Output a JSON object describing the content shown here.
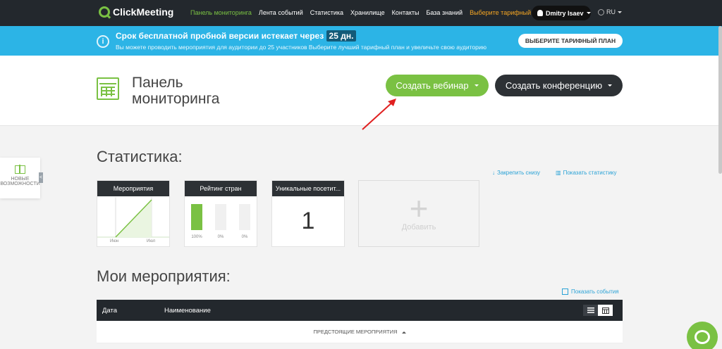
{
  "nav": {
    "logo": "ClickMeeting",
    "links": [
      "Панель мониторинга",
      "Лента событий",
      "Статистика",
      "Хранилище",
      "Контакты",
      "База знаний"
    ],
    "plan_link": "Выберите тарифный план",
    "user": "Dmitry Isaev",
    "lang": "RU"
  },
  "banner": {
    "title": "Срок бесплатной пробной версии истекает через",
    "days": "25 дн.",
    "subtitle": "Вы можете проводить мероприятия для аудитории до 25 участников Выберите лучший тарифный план и увеличьте свою аудиторию",
    "button": "ВЫБЕРИТЕ ТАРИФНЫЙ ПЛАН",
    "info_icon": "i"
  },
  "header": {
    "title": "Панель мониторинга",
    "webinar_button": "Создать вебинар",
    "conference_button": "Создать конференцию"
  },
  "side_panel": {
    "label": "НОВЫЕ ВОЗМОЖНОСТИ",
    "tab": "<"
  },
  "stats": {
    "title": "Статистика:",
    "pin_link": "Закрепить снизу",
    "show_link": "Показать статистику",
    "cards": [
      {
        "title": "Мероприятия",
        "x_labels": [
          "Июн",
          "Июл"
        ]
      },
      {
        "title": "Рейтинг стран",
        "bars": [
          100,
          0,
          0
        ],
        "bar_labels": [
          "100%",
          "0%",
          "0%"
        ]
      },
      {
        "title": "Уникальные посетит...",
        "value": "1"
      }
    ],
    "add_label": "Добавить",
    "add_symbol": "+"
  },
  "events": {
    "title": "Мои мероприятия:",
    "show_link": "Показать события",
    "col_date": "Дата",
    "col_name": "Наименование",
    "upcoming": "ПРЕДСТОЯЩИЕ МЕРОПРИЯТИЯ"
  },
  "colors": {
    "accent": "#7ac143",
    "banner": "#2cb4e6",
    "dark": "#23282d",
    "link": "#2aa2d6",
    "arrow": "#e02020"
  }
}
